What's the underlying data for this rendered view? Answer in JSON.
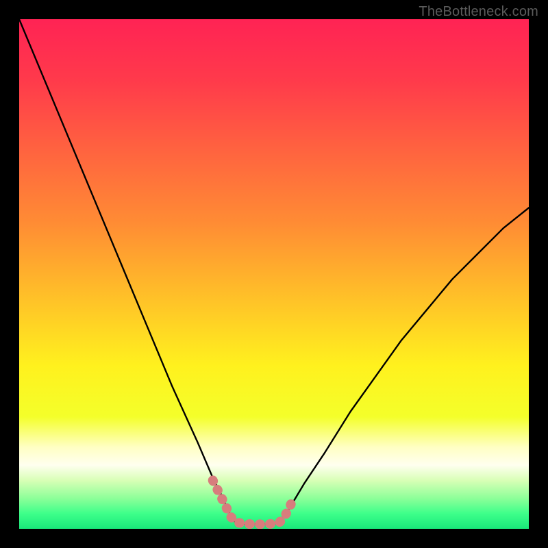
{
  "watermark": "TheBottleneck.com",
  "chart_data": {
    "type": "line",
    "title": "",
    "xlabel": "",
    "ylabel": "",
    "xlim": [
      0,
      100
    ],
    "ylim": [
      0,
      100
    ],
    "series": [
      {
        "name": "left-curve",
        "x": [
          0,
          5,
          10,
          15,
          20,
          25,
          30,
          35,
          38,
          40,
          41.5,
          42.5
        ],
        "values": [
          100,
          88,
          76,
          64,
          52,
          40,
          28,
          17,
          10,
          6,
          2.5,
          1.2
        ]
      },
      {
        "name": "flat-bottom",
        "x": [
          42.5,
          44,
          46,
          48,
          50,
          51
        ],
        "values": [
          1.2,
          1.0,
          0.9,
          0.9,
          1.0,
          1.2
        ]
      },
      {
        "name": "right-curve",
        "x": [
          51,
          53,
          56,
          60,
          65,
          70,
          75,
          80,
          85,
          90,
          95,
          100
        ],
        "values": [
          1.2,
          4,
          9,
          15,
          23,
          30,
          37,
          43,
          49,
          54,
          59,
          63
        ]
      },
      {
        "name": "overlay-marker",
        "x": [
          38,
          40,
          41.5,
          42.5,
          44,
          46,
          48,
          50,
          51,
          52,
          53.5
        ],
        "values": [
          9.5,
          5.5,
          2.4,
          1.3,
          1.0,
          0.9,
          0.9,
          1.0,
          1.2,
          2.2,
          5.2
        ]
      }
    ],
    "gradient_stops": [
      {
        "offset": 0.0,
        "color": "#ff2354"
      },
      {
        "offset": 0.12,
        "color": "#ff3a4b"
      },
      {
        "offset": 0.25,
        "color": "#ff6140"
      },
      {
        "offset": 0.4,
        "color": "#ff8c34"
      },
      {
        "offset": 0.55,
        "color": "#ffc228"
      },
      {
        "offset": 0.68,
        "color": "#fff11e"
      },
      {
        "offset": 0.78,
        "color": "#f4ff2a"
      },
      {
        "offset": 0.84,
        "color": "#ffffc4"
      },
      {
        "offset": 0.875,
        "color": "#ffffef"
      },
      {
        "offset": 0.905,
        "color": "#d8ffb6"
      },
      {
        "offset": 0.94,
        "color": "#8dff99"
      },
      {
        "offset": 0.97,
        "color": "#3eff8a"
      },
      {
        "offset": 1.0,
        "color": "#19e87a"
      }
    ],
    "colors": {
      "curve": "#000000",
      "marker": "#d77d7d",
      "frame": "#000000"
    }
  }
}
